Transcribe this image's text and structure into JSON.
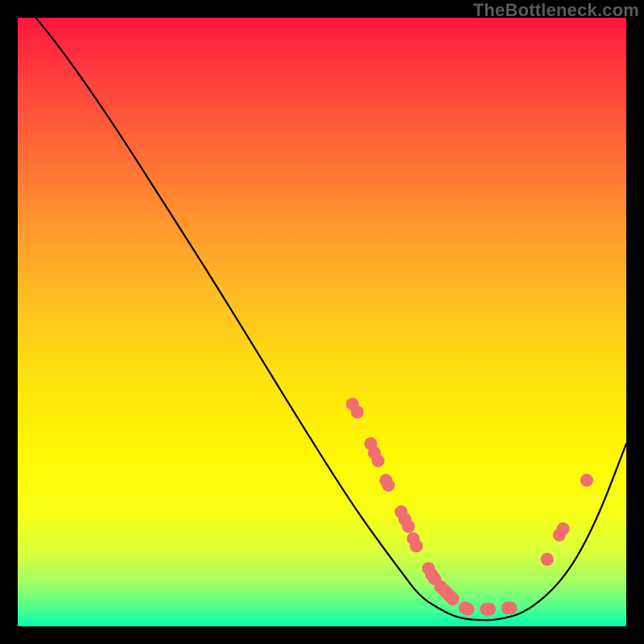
{
  "watermark": "TheBottleneck.com",
  "colors": {
    "curve": "#000000",
    "point_fill": "#f06e6e",
    "point_stroke": "#c94b4b"
  },
  "chart_data": {
    "type": "line",
    "title": "",
    "xlabel": "",
    "ylabel": "",
    "xlim": [
      0,
      100
    ],
    "ylim": [
      0,
      100
    ],
    "grid": false,
    "legend": false,
    "series": [
      {
        "name": "curve",
        "x": [
          3,
          7,
          12,
          18,
          25,
          32,
          40,
          48,
          55,
          60,
          63,
          66,
          69,
          72,
          75,
          79,
          84,
          90,
          95,
          100
        ],
        "y": [
          100,
          95,
          88,
          79,
          68,
          57,
          44,
          31,
          20,
          13,
          9,
          5,
          3,
          1.5,
          1,
          1,
          2.5,
          8,
          17,
          30
        ]
      }
    ],
    "points": [
      {
        "x": 55.0,
        "y": 36.5
      },
      {
        "x": 55.8,
        "y": 35.2
      },
      {
        "x": 58.0,
        "y": 30.0
      },
      {
        "x": 58.6,
        "y": 28.5
      },
      {
        "x": 59.2,
        "y": 27.2
      },
      {
        "x": 60.5,
        "y": 24.0
      },
      {
        "x": 60.9,
        "y": 23.2
      },
      {
        "x": 63.0,
        "y": 18.8
      },
      {
        "x": 63.6,
        "y": 17.6
      },
      {
        "x": 64.2,
        "y": 16.4
      },
      {
        "x": 65.0,
        "y": 14.4
      },
      {
        "x": 65.5,
        "y": 13.2
      },
      {
        "x": 67.5,
        "y": 9.5
      },
      {
        "x": 68.0,
        "y": 8.5
      },
      {
        "x": 68.5,
        "y": 7.8
      },
      {
        "x": 69.5,
        "y": 6.5
      },
      {
        "x": 70.0,
        "y": 6.0
      },
      {
        "x": 70.5,
        "y": 5.5
      },
      {
        "x": 71.0,
        "y": 5.0
      },
      {
        "x": 71.5,
        "y": 4.5
      },
      {
        "x": 73.5,
        "y": 3.0
      },
      {
        "x": 74.0,
        "y": 2.8
      },
      {
        "x": 77.0,
        "y": 2.8
      },
      {
        "x": 77.5,
        "y": 2.8
      },
      {
        "x": 80.5,
        "y": 3.0
      },
      {
        "x": 81.0,
        "y": 3.0
      },
      {
        "x": 87.0,
        "y": 11.0
      },
      {
        "x": 89.0,
        "y": 15.0
      },
      {
        "x": 89.6,
        "y": 16.0
      },
      {
        "x": 93.5,
        "y": 24.0
      }
    ]
  }
}
